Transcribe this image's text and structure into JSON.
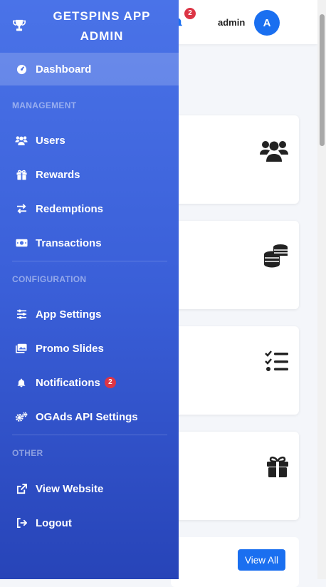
{
  "brand": {
    "line1": "GETSPINS APP",
    "line2": "ADMIN"
  },
  "header": {
    "notification_count": "2",
    "user_name": "admin",
    "avatar_initial": "A"
  },
  "sidebar": {
    "dashboard": "Dashboard",
    "sections": {
      "management": "MANAGEMENT",
      "configuration": "CONFIGURATION",
      "other": "OTHER"
    },
    "management_items": [
      "Users",
      "Rewards",
      "Redemptions",
      "Transactions"
    ],
    "configuration_items": [
      "App Settings",
      "Promo Slides",
      "Notifications",
      "OGAds API Settings"
    ],
    "notifications_badge": "2",
    "other_items": [
      "View Website",
      "Logout"
    ]
  },
  "main": {
    "view_all_label": "View All"
  },
  "colors": {
    "accent": "#1a6ff0",
    "badge": "#dc3545",
    "sidebar_top": "#4a73e8",
    "sidebar_bottom": "#2744b8"
  },
  "icons": {
    "cards": [
      "users-icon",
      "coins-icon",
      "tasks-icon",
      "gift-icon"
    ],
    "sidebar": [
      "trophy-icon",
      "dashboard-icon",
      "users-icon",
      "gift-icon",
      "exchange-icon",
      "money-icon",
      "sliders-icon",
      "images-icon",
      "bell-icon",
      "cogs-icon",
      "external-link-icon",
      "logout-icon"
    ]
  }
}
